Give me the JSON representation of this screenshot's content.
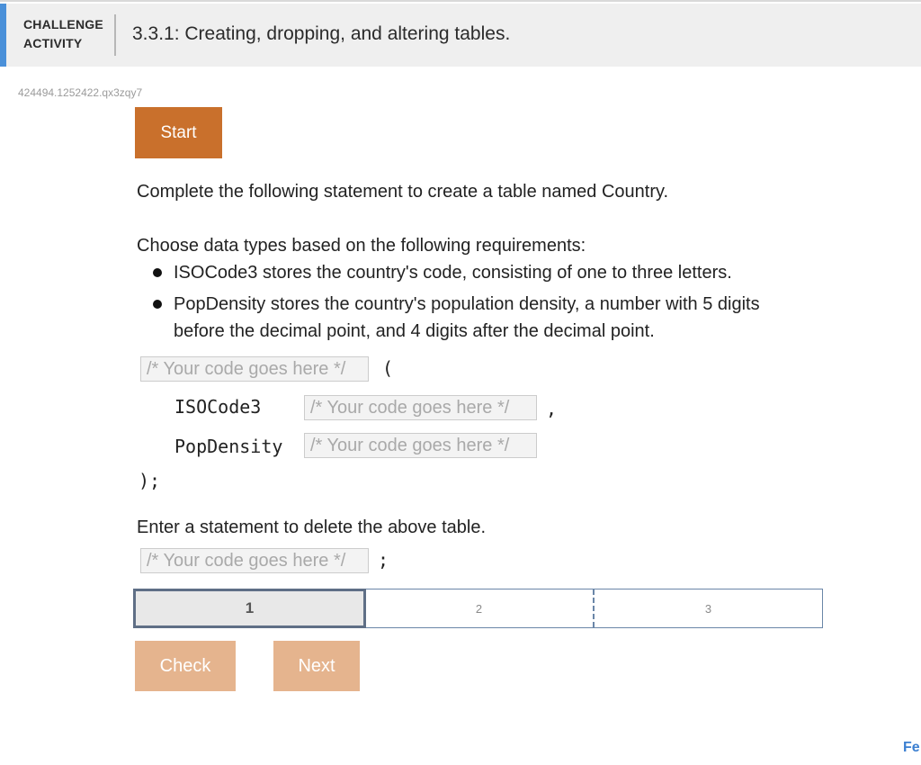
{
  "header": {
    "tag_line1": "CHALLENGE",
    "tag_line2": "ACTIVITY",
    "title": "3.3.1: Creating, dropping, and altering tables."
  },
  "activity_id": "424494.1252422.qx3zqy7",
  "start_label": "Start",
  "instructions": {
    "line1": "Complete the following statement to create a table named Country.",
    "line2": "Choose data types based on the following requirements:",
    "bullets": [
      {
        "line1": "ISOCode3 stores the country's code, consisting of one to three letters.",
        "line2": ""
      },
      {
        "line1": "PopDensity stores the country's population density, a number with 5 digits",
        "line2": "before the decimal point, and 4 digits after the decimal point."
      }
    ]
  },
  "code": {
    "placeholder": "/* Your code goes here */",
    "open_paren": "(",
    "col1": "ISOCode3",
    "comma": ",",
    "col2": "PopDensity",
    "close": ");",
    "semicolon": ";"
  },
  "delete_prompt": "Enter a statement to delete the above table.",
  "steps": [
    "1",
    "2",
    "3"
  ],
  "buttons": {
    "check": "Check",
    "next": "Next"
  },
  "corner_link": "Fe",
  "colors": {
    "start_button": "#c9702c",
    "disabled_button": "#e5b48e",
    "accent": "#4a90d9",
    "step_border": "#6a86a8"
  }
}
